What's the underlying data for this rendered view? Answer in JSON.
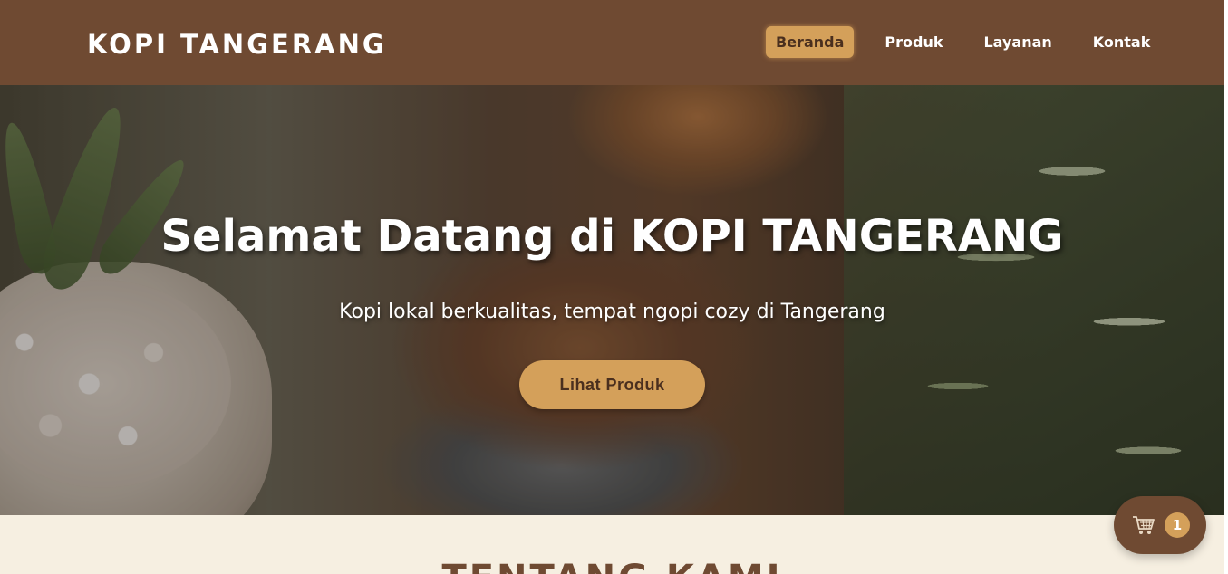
{
  "brand": {
    "logo_text": "KOPI TANGERANG"
  },
  "nav": {
    "items": [
      {
        "label": "Beranda",
        "active": true
      },
      {
        "label": "Produk",
        "active": false
      },
      {
        "label": "Layanan",
        "active": false
      },
      {
        "label": "Kontak",
        "active": false
      }
    ]
  },
  "hero": {
    "title": "Selamat Datang di KOPI TANGERANG",
    "subtitle": "Kopi lokal berkualitas, tempat ngopi cozy di Tangerang",
    "cta_label": "Lihat Produk"
  },
  "about": {
    "title": "TENTANG KAMI"
  },
  "cart": {
    "icon": "shopping-cart-icon",
    "count": "1"
  },
  "colors": {
    "primary": "#6f4a32",
    "accent": "#d4a05a",
    "background": "#f6efe1",
    "text_light": "#ffffff"
  }
}
